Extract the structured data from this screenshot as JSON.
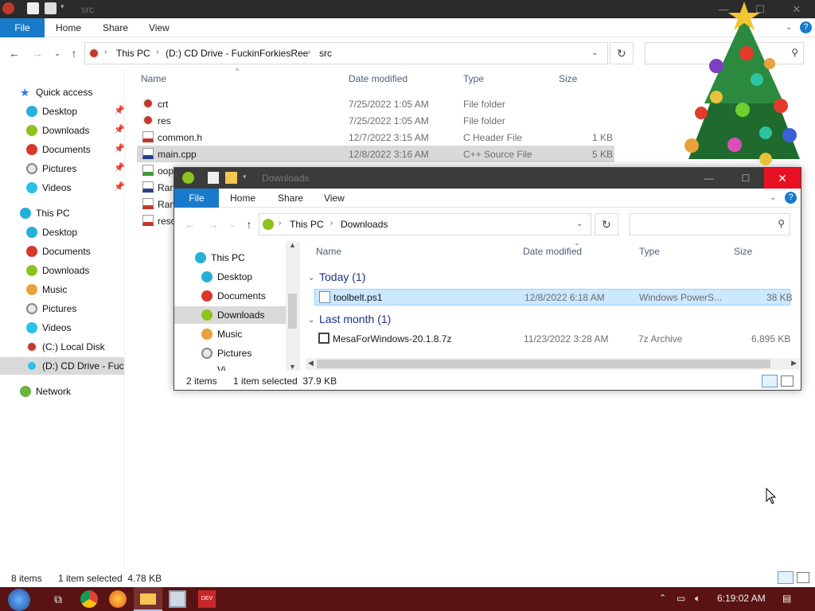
{
  "main": {
    "title": "src",
    "ribbon_tabs": [
      "File",
      "Home",
      "Share",
      "View"
    ],
    "path": [
      "This PC",
      "(D:) CD Drive - FuckinForkiesRee",
      "src"
    ],
    "columns": [
      "Name",
      "Date modified",
      "Type",
      "Size"
    ],
    "files": [
      {
        "name": "crt",
        "date": "7/25/2022 1:05 AM",
        "type": "File folder",
        "size": ""
      },
      {
        "name": "res",
        "date": "7/25/2022 1:05 AM",
        "type": "File folder",
        "size": ""
      },
      {
        "name": "common.h",
        "date": "12/7/2022 3:15 AM",
        "type": "C Header File",
        "size": "1 KB"
      },
      {
        "name": "main.cpp",
        "date": "12/8/2022 3:16 AM",
        "type": "C++ Source File",
        "size": "5 KB"
      },
      {
        "name": "oop",
        "date": "",
        "type": "",
        "size": ""
      },
      {
        "name": "Ran",
        "date": "",
        "type": "",
        "size": ""
      },
      {
        "name": "Ran",
        "date": "",
        "type": "",
        "size": ""
      },
      {
        "name": "reso",
        "date": "",
        "type": "",
        "size": ""
      }
    ],
    "nav": {
      "quick_access": "Quick access",
      "quick_items": [
        "Desktop",
        "Downloads",
        "Documents",
        "Pictures",
        "Videos"
      ],
      "this_pc": "This PC",
      "pc_items": [
        "Desktop",
        "Documents",
        "Downloads",
        "Music",
        "Pictures",
        "Videos",
        "(C:) Local Disk",
        "(D:) CD Drive - Fuck"
      ],
      "network": "Network"
    },
    "status": {
      "items": "8 items",
      "selected": "1 item selected  4.78 KB"
    }
  },
  "downloads": {
    "title": "Downloads",
    "ribbon_tabs": [
      "File",
      "Home",
      "Share",
      "View"
    ],
    "path": [
      "This PC",
      "Downloads"
    ],
    "columns": [
      "Name",
      "Date modified",
      "Type",
      "Size"
    ],
    "groups": [
      {
        "label": "Today (1)",
        "files": [
          {
            "name": "toolbelt.ps1",
            "date": "12/8/2022 6:18 AM",
            "type": "Windows PowerS...",
            "size": "38 KB"
          }
        ]
      },
      {
        "label": "Last month (1)",
        "files": [
          {
            "name": "MesaForWindows-20.1.8.7z",
            "date": "11/23/2022 3:28 AM",
            "type": "7z Archive",
            "size": "6,895 KB"
          }
        ]
      }
    ],
    "nav": [
      "This PC",
      "Desktop",
      "Documents",
      "Downloads",
      "Music",
      "Pictures",
      "Vi"
    ],
    "status": {
      "items": "2 items",
      "selected": "1 item selected  37.9 KB"
    }
  },
  "taskbar": {
    "time": "6:19:02 AM"
  },
  "colors": {
    "accent": "#1979ca",
    "taskbar": "#5a1313",
    "close": "#e81123",
    "selection": "#cce8ff"
  }
}
